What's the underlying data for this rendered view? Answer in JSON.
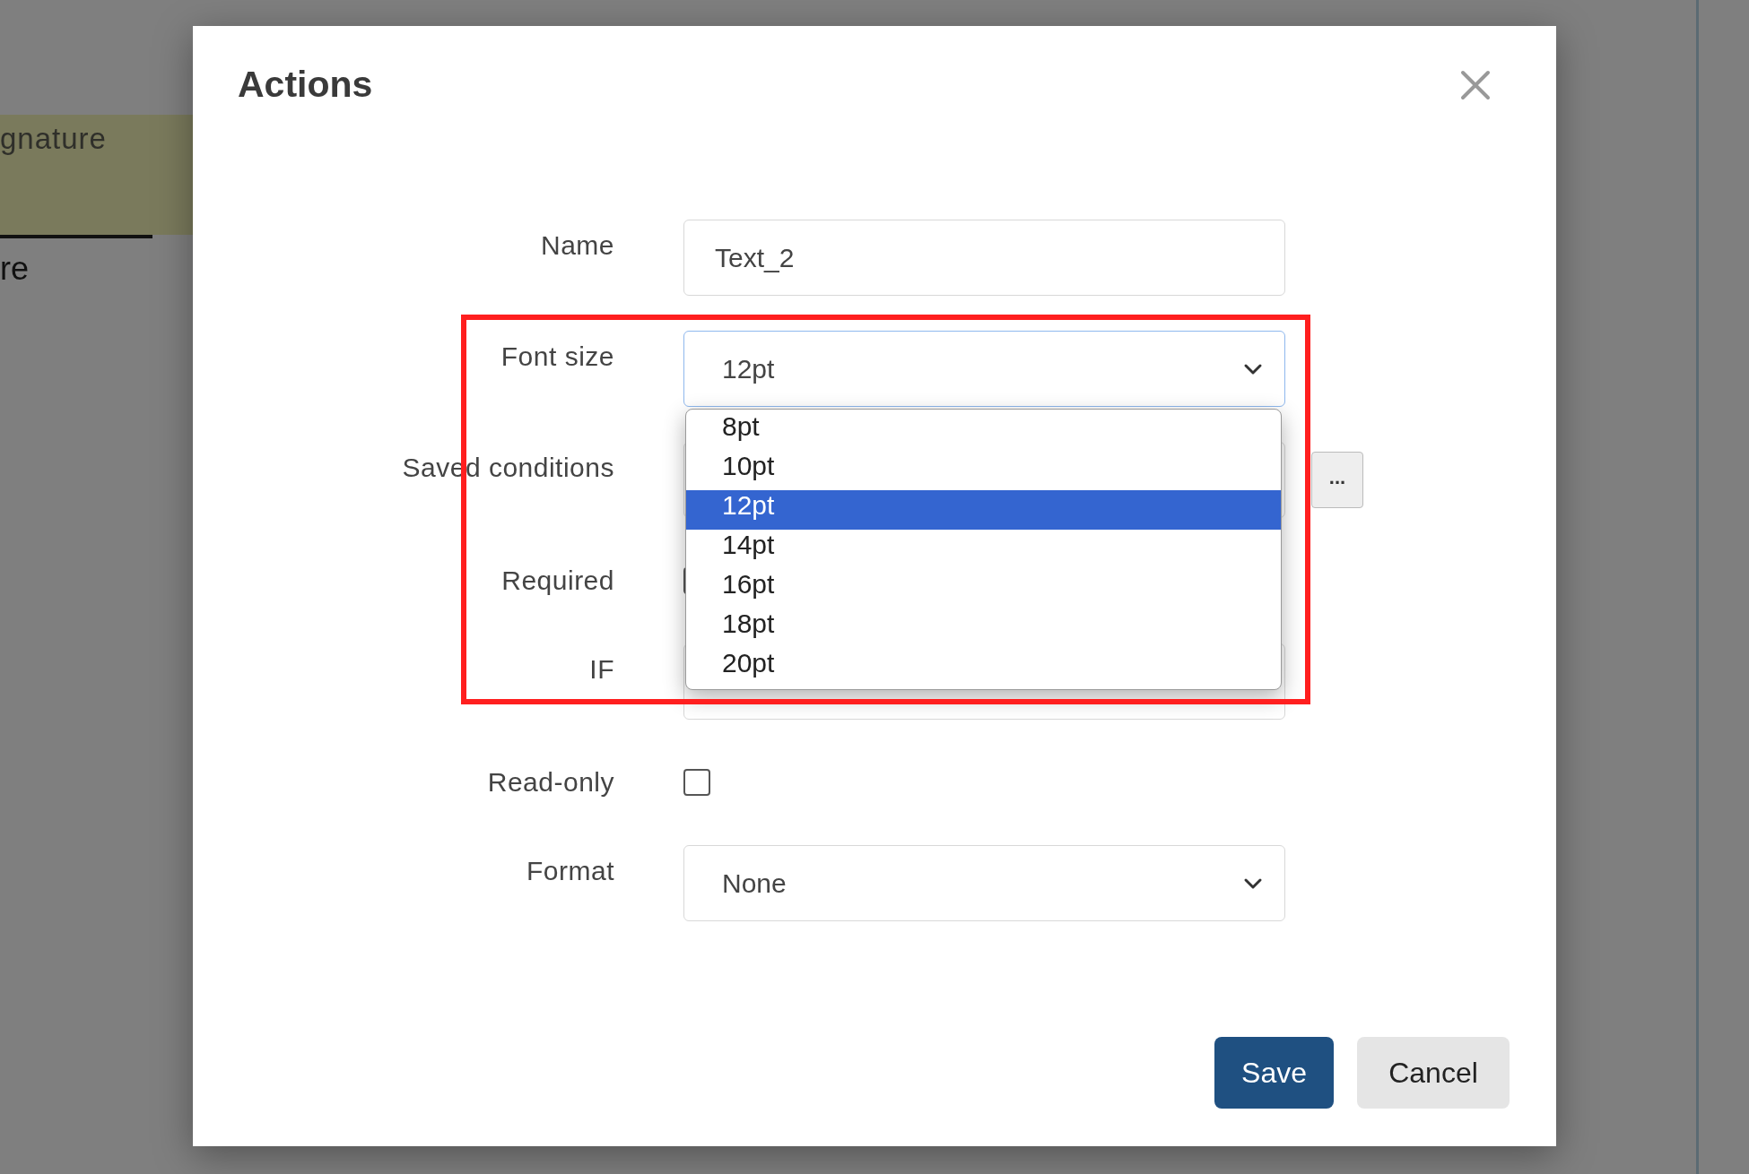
{
  "background_page": {
    "texts": [
      {
        "text": "gnature",
        "kind": "tag"
      },
      {
        "text": "re",
        "kind": "plain"
      }
    ]
  },
  "dialog": {
    "title": "Actions",
    "fields": [
      {
        "label": "Name",
        "kind": "text",
        "value": "Text_2"
      },
      {
        "label": "Font size",
        "kind": "select",
        "value": "12pt",
        "expanded": true,
        "options": [
          {
            "label": "8pt",
            "selected": false
          },
          {
            "label": "10pt",
            "selected": false
          },
          {
            "label": "12pt",
            "selected": true
          },
          {
            "label": "14pt",
            "selected": false
          },
          {
            "label": "16pt",
            "selected": false
          },
          {
            "label": "18pt",
            "selected": false
          },
          {
            "label": "20pt",
            "selected": false
          }
        ]
      },
      {
        "label": "Saved conditions",
        "kind": "select-more",
        "more": "..."
      },
      {
        "label": "Required",
        "kind": "checkbox"
      },
      {
        "label": "IF",
        "kind": "select"
      },
      {
        "label": "Read-only",
        "kind": "checkbox",
        "checked": false
      },
      {
        "label": "Format",
        "kind": "select",
        "value": "None"
      }
    ],
    "buttons": [
      {
        "label": "Save",
        "kind": "primary"
      },
      {
        "label": "Cancel",
        "kind": "secondary"
      }
    ]
  }
}
